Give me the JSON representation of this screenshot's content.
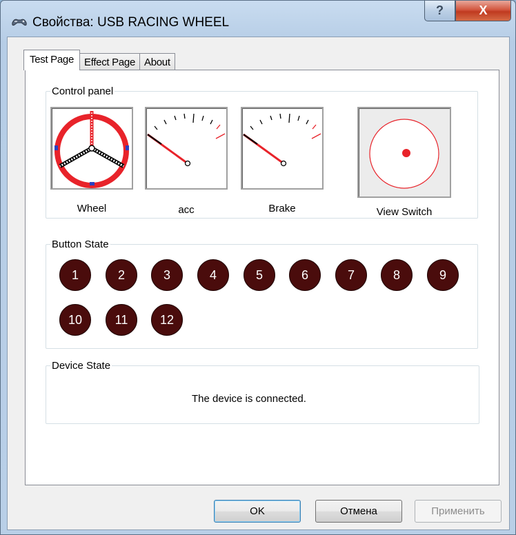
{
  "window": {
    "title": "Свойства: USB RACING WHEEL",
    "help_label": "?",
    "close_label": "X"
  },
  "tabs": [
    {
      "label": "Test Page",
      "active": true
    },
    {
      "label": "Effect Page",
      "active": false
    },
    {
      "label": "About",
      "active": false
    }
  ],
  "control_panel": {
    "legend": "Control panel",
    "wheel_label": "Wheel",
    "acc_label": "acc",
    "brake_label": "Brake",
    "view_switch_label": "View Switch"
  },
  "button_state": {
    "legend": "Button State",
    "buttons": [
      "1",
      "2",
      "3",
      "4",
      "5",
      "6",
      "7",
      "8",
      "9",
      "10",
      "11",
      "12"
    ]
  },
  "device_state": {
    "legend": "Device State",
    "message": "The device is connected."
  },
  "footer": {
    "ok_label": "OK",
    "cancel_label": "Отмена",
    "apply_label": "Применить"
  },
  "colors": {
    "indicator_red": "#e8232a",
    "button_fill": "#4a0c0c",
    "accent_blue": "#3c7fb1"
  }
}
